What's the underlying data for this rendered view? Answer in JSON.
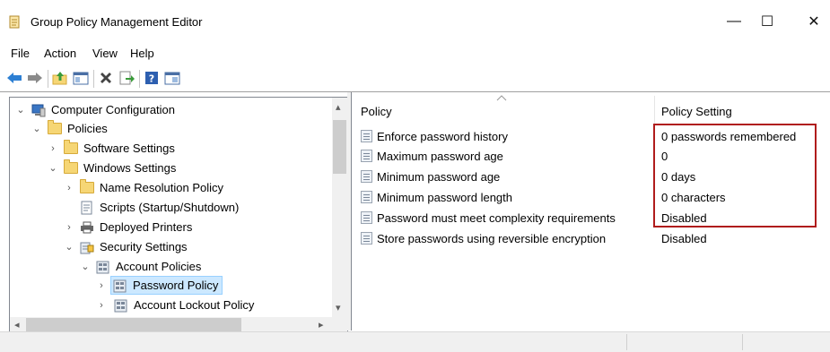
{
  "window": {
    "title": "Group Policy Management Editor",
    "icon": "group-policy-icon",
    "controls": [
      "minimize-icon",
      "maximize-icon",
      "close-icon"
    ],
    "minimize_glyph": "—",
    "maximize_glyph": "☐",
    "close_glyph": "✕"
  },
  "menu": [
    "File",
    "Action",
    "View",
    "Help"
  ],
  "toolbar": {
    "icons": [
      "back-arrow-icon",
      "forward-arrow-icon",
      "up-folder-icon",
      "show-hide-tree-icon",
      "delete-icon",
      "export-list-icon",
      "help-icon",
      "properties-icon"
    ]
  },
  "tree": {
    "items": [
      {
        "label": "Computer Configuration",
        "expander": "expanded",
        "icon": "computer-icon",
        "level": 0
      },
      {
        "label": "Policies",
        "expander": "expanded",
        "icon": "folder-icon",
        "level": 1
      },
      {
        "label": "Software Settings",
        "expander": "collapsed",
        "icon": "folder-icon",
        "level": 2
      },
      {
        "label": "Windows Settings",
        "expander": "expanded",
        "icon": "folder-icon",
        "level": 2
      },
      {
        "label": "Name Resolution Policy",
        "expander": "collapsed",
        "icon": "folder-icon",
        "level": 3
      },
      {
        "label": "Scripts (Startup/Shutdown)",
        "expander": "none",
        "icon": "script-icon",
        "level": 3
      },
      {
        "label": "Deployed Printers",
        "expander": "collapsed",
        "icon": "printer-icon",
        "level": 3
      },
      {
        "label": "Security Settings",
        "expander": "expanded",
        "icon": "security-settings-icon",
        "level": 3
      },
      {
        "label": "Account Policies",
        "expander": "expanded",
        "icon": "policy-folder-icon",
        "level": 4
      },
      {
        "label": "Password Policy",
        "expander": "collapsed",
        "icon": "policy-folder-icon",
        "level": 5,
        "selected": true
      },
      {
        "label": "Account Lockout Policy",
        "expander": "collapsed",
        "icon": "policy-folder-icon",
        "level": 5
      }
    ]
  },
  "list": {
    "columns": {
      "policy": "Policy",
      "setting": "Policy Setting"
    },
    "rows": [
      {
        "policy": "Enforce password history",
        "setting": "0 passwords remembered"
      },
      {
        "policy": "Maximum password age",
        "setting": "0"
      },
      {
        "policy": "Minimum password age",
        "setting": "0 days"
      },
      {
        "policy": "Minimum password length",
        "setting": "0 characters"
      },
      {
        "policy": "Password must meet complexity requirements",
        "setting": "Disabled"
      },
      {
        "policy": "Store passwords using reversible encryption",
        "setting": "Disabled"
      }
    ],
    "sort_indicator": "sort-ascending-icon"
  },
  "colors": {
    "highlight_box": "#b01c1c",
    "selection_bg": "#cce8ff"
  }
}
